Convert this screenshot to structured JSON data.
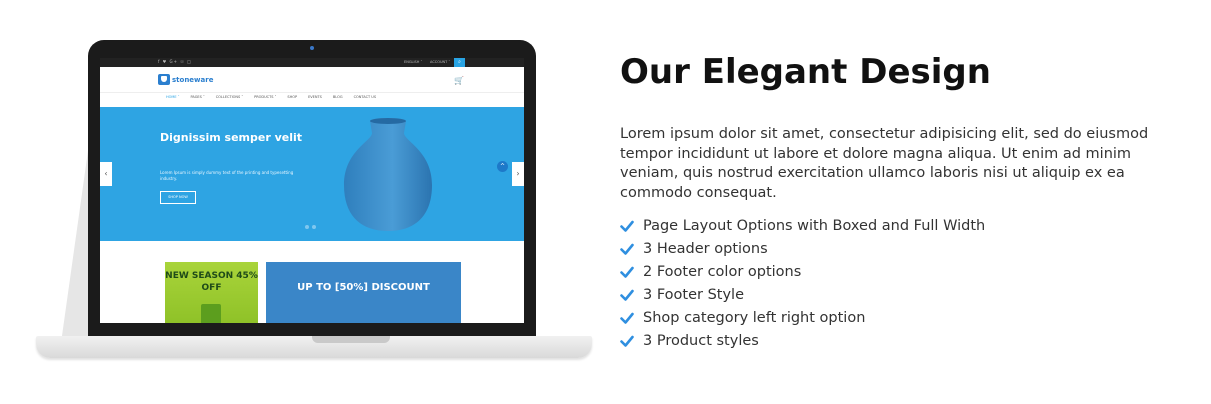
{
  "heading": "Our Elegant Design",
  "description": "Lorem ipsum dolor sit amet, consectetur adipisicing elit, sed do eiusmod tempor incididunt ut labore et dolore magna aliqua. Ut enim ad minim veniam, quis nostrud exercitation ullamco laboris nisi ut aliquip ex ea commodo consequat.",
  "features": [
    "Page Layout Options with Boxed and Full Width",
    "3 Header options",
    "2 Footer color options",
    "3 Footer Style",
    "Shop category left right option",
    "3 Product styles"
  ],
  "colors": {
    "accent": "#29a4e4",
    "check": "#2f8fe0",
    "slider_bg": "#2ea4e3",
    "vase": "#3e8fcc"
  },
  "mockup": {
    "social_icons": "f  ♥  G+  ☉  □",
    "language": "ENGLISH ˅",
    "account": "ACCOUNT ˅",
    "search_icon": "search-icon",
    "logo_text": "stoneware",
    "cart_icon": "cart-icon",
    "nav": [
      "HOME ˅",
      "PAGES ˅",
      "COLLECTIONS ˅",
      "PRODUCTS ˅",
      "SHOP",
      "EVENTS",
      "BLOG",
      "CONTACT US"
    ],
    "slide_title": "Dignissim semper velit",
    "slide_text": "Lorem Ipsum is simply dummy text of the printing and typesetting industry.",
    "slide_button": "SHOP NOW",
    "banner1": "NEW SEASON 45% OFF",
    "banner2": "UP TO [50%] DISCOUNT"
  }
}
